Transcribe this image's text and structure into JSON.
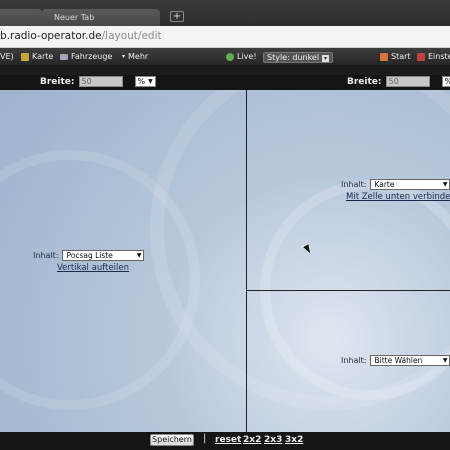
{
  "browser": {
    "tabs": [
      {
        "label": ""
      },
      {
        "label": "Neuer Tab"
      }
    ],
    "new_tab_icon": "plus-icon",
    "url_host": "b.radio-operator.de",
    "url_path": "/layout/edit"
  },
  "nav": {
    "items": [
      {
        "label": "VE)",
        "icon": ""
      },
      {
        "label": "Karte",
        "icon": "map-icon",
        "color": "#c9a63a"
      },
      {
        "label": "Fahrzeuge",
        "icon": "truck-icon",
        "color": "#9aa7b8"
      },
      {
        "label": "Mehr",
        "icon": "chevron-down-icon",
        "color": "#cccccc"
      },
      {
        "label": "Live!",
        "icon": "live-icon",
        "color": "#5fae4e"
      },
      {
        "label": "Start",
        "icon": "home-icon",
        "color": "#d9743a"
      },
      {
        "label": "Einste",
        "icon": "settings-icon",
        "color": "#c0443a"
      }
    ],
    "style_label": "Style:",
    "style_value": "dunkel"
  },
  "width_bar": {
    "left": {
      "label": "Breite:",
      "value": "50",
      "unit": "%"
    },
    "right": {
      "label": "Breite:",
      "value": "50",
      "unit": "%"
    }
  },
  "cells": {
    "left": {
      "content_label": "Inhalt:",
      "content_value": "Pocsag Liste",
      "action": "Vertikal aufteilen"
    },
    "top_right": {
      "content_label": "Inhalt:",
      "content_value": "Karte",
      "action": "Mit Zelle unten verbinden"
    },
    "bottom_right": {
      "content_label": "Inhalt:",
      "content_value": "Bitte Wählen"
    }
  },
  "bottom": {
    "save_label": "Speichern",
    "separator": "|",
    "links": [
      "reset",
      "2x2",
      "2x3",
      "3x2"
    ]
  }
}
